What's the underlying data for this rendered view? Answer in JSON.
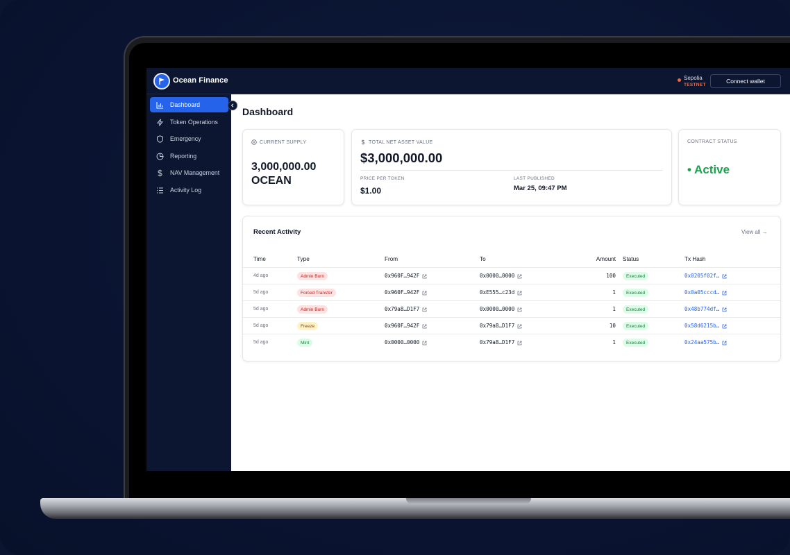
{
  "app": {
    "brand": "Ocean Finance",
    "network_name": "Sepolia",
    "network_tag": "TESTNET",
    "connect_label": "Connect wallet"
  },
  "sidebar": {
    "items": [
      {
        "label": "Dashboard",
        "icon": "bar-chart-icon",
        "active": true
      },
      {
        "label": "Token Operations",
        "icon": "lightning-icon",
        "active": false
      },
      {
        "label": "Emergency",
        "icon": "shield-icon",
        "active": false
      },
      {
        "label": "Reporting",
        "icon": "pie-chart-icon",
        "active": false
      },
      {
        "label": "NAV Management",
        "icon": "dollar-icon",
        "active": false
      },
      {
        "label": "Activity Log",
        "icon": "list-icon",
        "active": false
      }
    ]
  },
  "page": {
    "title": "Dashboard"
  },
  "cards": {
    "supply": {
      "label": "CURRENT SUPPLY",
      "value_line1": "3,000,000.00",
      "value_line2": "OCEAN"
    },
    "nav": {
      "label": "TOTAL NET ASSET VALUE",
      "value": "$3,000,000.00",
      "price_label": "PRICE PER TOKEN",
      "price_value": "$1.00",
      "published_label": "LAST PUBLISHED",
      "published_value": "Mar 25, 09:47 PM"
    },
    "status": {
      "label": "CONTRACT STATUS",
      "value": "• Active"
    }
  },
  "activity": {
    "title": "Recent Activity",
    "view_all": "View all →",
    "columns": [
      "Time",
      "Type",
      "From",
      "To",
      "Amount",
      "Status",
      "Tx Hash"
    ],
    "rows": [
      {
        "time": "4d ago",
        "type": "Admin Burn",
        "type_color": "red",
        "from": "0x960F…942F",
        "to": "0x0000…0000",
        "amount": "100",
        "status": "Executed",
        "hash": "0x0205f02f…"
      },
      {
        "time": "5d ago",
        "type": "Forced Transfer",
        "type_color": "red",
        "from": "0x960F…942F",
        "to": "0xE555…c23d",
        "amount": "1",
        "status": "Executed",
        "hash": "0x0a05cccd…"
      },
      {
        "time": "5d ago",
        "type": "Admin Burn",
        "type_color": "red",
        "from": "0x79a8…D1F7",
        "to": "0x0000…0000",
        "amount": "1",
        "status": "Executed",
        "hash": "0x48b774df…"
      },
      {
        "time": "5d ago",
        "type": "Freeze",
        "type_color": "amber",
        "from": "0x960F…942F",
        "to": "0x79a8…D1F7",
        "amount": "10",
        "status": "Executed",
        "hash": "0x58d6215b…"
      },
      {
        "time": "5d ago",
        "type": "Mint",
        "type_color": "green",
        "from": "0x0000…0000",
        "to": "0x79a8…D1F7",
        "amount": "1",
        "status": "Executed",
        "hash": "0x24aa575b…"
      }
    ]
  },
  "colors": {
    "accent": "#2563eb",
    "sidebar_bg": "#0c1630",
    "active_status": "#16a34a",
    "testnet": "#f0683c"
  }
}
